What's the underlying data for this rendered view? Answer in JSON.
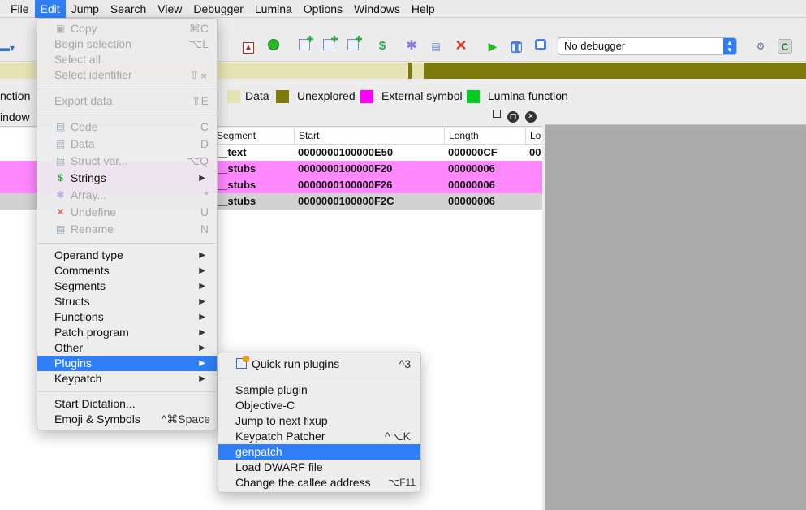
{
  "menubar": {
    "items": [
      "File",
      "Edit",
      "Jump",
      "Search",
      "View",
      "Debugger",
      "Lumina",
      "Options",
      "Windows",
      "Help"
    ],
    "active": "Edit"
  },
  "toolbar": {
    "debugger_select": "No debugger"
  },
  "legend": {
    "items": [
      {
        "label": "nction",
        "color": "#0066cc"
      },
      {
        "label": "Data",
        "color": "#e7e4b4"
      },
      {
        "label": "Unexplored",
        "color": "#7c7a0a"
      },
      {
        "label": "External symbol",
        "color": "#ff00ff"
      },
      {
        "label": "Lumina function",
        "color": "#00cc22"
      }
    ]
  },
  "segments_panel": {
    "title": "indow",
    "columns": [
      "Segment",
      "Start",
      "Length",
      "Lo"
    ],
    "rows": [
      {
        "segment": "__text",
        "start": "0000000100000E50",
        "length": "000000CF",
        "extra": "00",
        "color": "#ffffff"
      },
      {
        "segment": "__stubs",
        "start": "0000000100000F20",
        "length": "00000006",
        "extra": "",
        "color": "#ff88ff"
      },
      {
        "segment": "__stubs",
        "start": "0000000100000F26",
        "length": "00000006",
        "extra": "",
        "color": "#ff88ff"
      },
      {
        "segment": "__stubs",
        "start": "0000000100000F2C",
        "length": "00000006",
        "extra": "",
        "color": "#d2d2d2"
      }
    ]
  },
  "edit_menu": {
    "items": [
      {
        "label": "Copy",
        "shortcut": "⌘C",
        "disabled": true,
        "icon": "copy-icon"
      },
      {
        "label": "Begin selection",
        "shortcut": "⌥L",
        "disabled": true
      },
      {
        "label": "Select all",
        "shortcut": "",
        "disabled": true
      },
      {
        "label": "Select identifier",
        "shortcut": "⇧⌅",
        "disabled": true
      },
      {
        "label": "Export data",
        "shortcut": "⇧E",
        "disabled": true
      },
      {
        "label": "Code",
        "shortcut": "C",
        "disabled": true,
        "icon": "code-icon"
      },
      {
        "label": "Data",
        "shortcut": "D",
        "disabled": true,
        "icon": "data-icon"
      },
      {
        "label": "Struct var...",
        "shortcut": "⌥Q",
        "disabled": true,
        "icon": "struct-icon"
      },
      {
        "label": "Strings",
        "shortcut": "",
        "disabled": false,
        "submenu": true,
        "icon": "strings-icon"
      },
      {
        "label": "Array...",
        "shortcut": "*",
        "disabled": true,
        "icon": "array-icon"
      },
      {
        "label": "Undefine",
        "shortcut": "U",
        "disabled": true,
        "icon": "undefine-icon"
      },
      {
        "label": "Rename",
        "shortcut": "N",
        "disabled": true,
        "icon": "rename-icon"
      },
      {
        "label": "Operand type",
        "submenu": true
      },
      {
        "label": "Comments",
        "submenu": true
      },
      {
        "label": "Segments",
        "submenu": true
      },
      {
        "label": "Structs",
        "submenu": true
      },
      {
        "label": "Functions",
        "submenu": true
      },
      {
        "label": "Patch program",
        "submenu": true
      },
      {
        "label": "Other",
        "submenu": true
      },
      {
        "label": "Plugins",
        "submenu": true,
        "highlighted": true
      },
      {
        "label": "Keypatch",
        "submenu": true
      },
      {
        "label": "Start Dictation...",
        "shortcut": ""
      },
      {
        "label": "Emoji & Symbols",
        "shortcut": "^⌘Space"
      }
    ]
  },
  "plugins_menu": {
    "items": [
      {
        "label": "Quick run plugins",
        "shortcut": "^3",
        "icon": "quick-run-icon"
      },
      {
        "label": "Sample plugin",
        "shortcut": ""
      },
      {
        "label": "Objective-C",
        "shortcut": ""
      },
      {
        "label": "Jump to next fixup",
        "shortcut": ""
      },
      {
        "label": "Keypatch Patcher",
        "shortcut": "^⌥K"
      },
      {
        "label": "genpatch",
        "shortcut": "",
        "highlighted": true
      },
      {
        "label": "Load DWARF file",
        "shortcut": ""
      },
      {
        "label": "Change the callee address",
        "shortcut": "⌥F11"
      }
    ]
  },
  "colors": {
    "accent": "#2f7ef6",
    "stub_row": "#ff88ff",
    "unexplored": "#7c7a0a",
    "data": "#e7e4b4"
  }
}
